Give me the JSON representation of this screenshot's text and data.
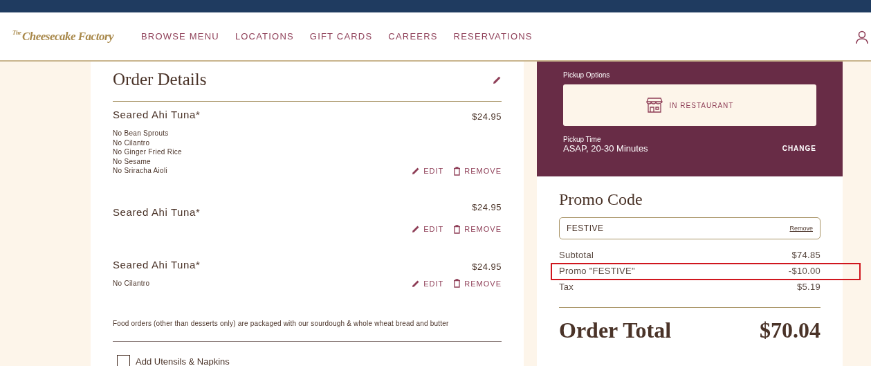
{
  "logo": {
    "small": "The",
    "main": "Cheesecake Factory"
  },
  "nav": [
    "BROWSE MENU",
    "LOCATIONS",
    "GIFT CARDS",
    "CAREERS",
    "RESERVATIONS"
  ],
  "order": {
    "title": "Order Details",
    "items": [
      {
        "name": "Seared Ahi Tuna*",
        "price": "$24.95",
        "modifiers": [
          "No Bean Sprouts",
          "No Cilantro",
          "No Ginger Fried Rice",
          "No Sesame",
          "No Sriracha Aioli"
        ],
        "edit": "EDIT",
        "remove": "REMOVE"
      },
      {
        "name": "Seared Ahi Tuna*",
        "price": "$24.95",
        "edit": "EDIT",
        "remove": "REMOVE"
      },
      {
        "name": "Seared Ahi Tuna*",
        "price": "$24.95",
        "modifiers": [
          "No Cilantro"
        ],
        "edit": "EDIT",
        "remove": "REMOVE"
      }
    ],
    "note": "Food orders (other than desserts only) are packaged with our sourdough & whole wheat bread and butter",
    "utensils": {
      "label": "Add Utensils & Napkins",
      "checked": false
    }
  },
  "pickup": {
    "options_label": "Pickup Options",
    "option": "IN RESTAURANT",
    "time_label": "Pickup Time",
    "time": "ASAP, 20-30 Minutes",
    "change": "CHANGE"
  },
  "promo": {
    "title": "Promo Code",
    "code": "FESTIVE",
    "remove": "Remove"
  },
  "summary": [
    {
      "label": "Subtotal",
      "value": "$74.85",
      "highlighted": false
    },
    {
      "label": "Promo \"FESTIVE\"",
      "value": "-$10.00",
      "highlighted": true
    },
    {
      "label": "Tax",
      "value": "$5.19",
      "highlighted": false
    }
  ],
  "total": {
    "label": "Order Total",
    "value": "$70.04"
  }
}
